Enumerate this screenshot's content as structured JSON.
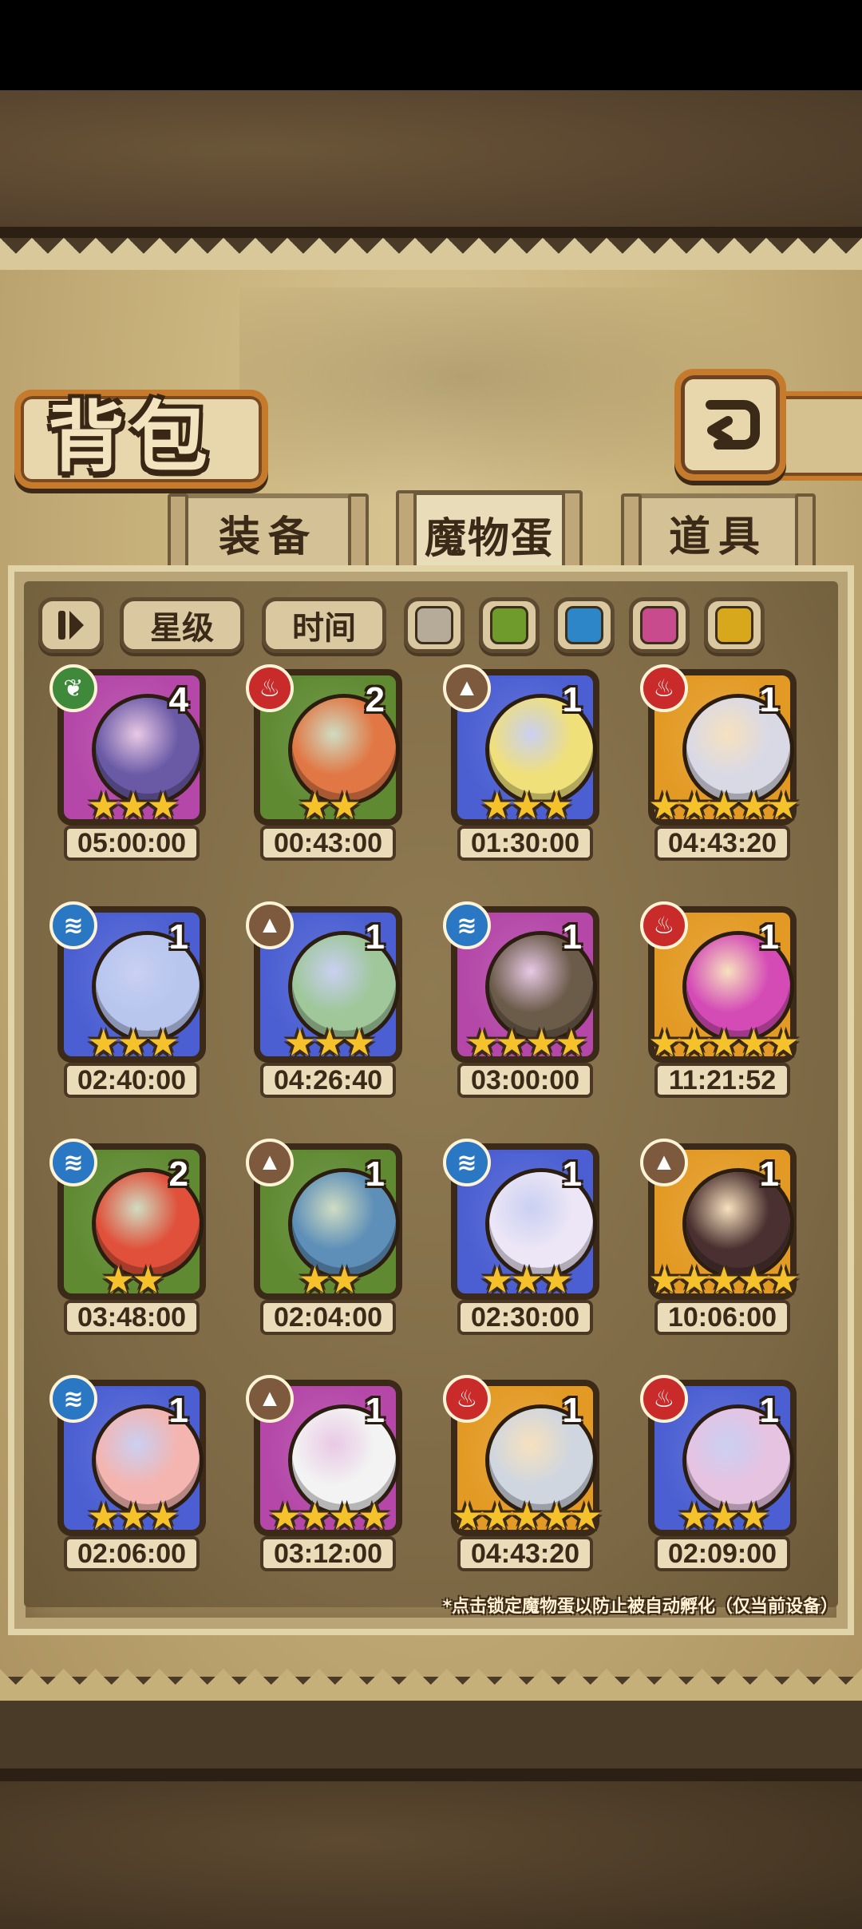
{
  "title": "背包",
  "back_icon": "back-arrow-icon",
  "tabs": [
    {
      "label": "装备",
      "active": false
    },
    {
      "label": "魔物蛋",
      "active": true
    },
    {
      "label": "道具",
      "active": false
    }
  ],
  "filters": {
    "pause_icon": "sort-toggle-icon",
    "star_label": "星级",
    "time_label": "时间",
    "colors": [
      "#b5ab98",
      "#6f9a2c",
      "#2c86c8",
      "#c84b8e",
      "#d7a71c"
    ]
  },
  "element_colors": {
    "nature": "#3e8a3a",
    "fire": "#c92a2a",
    "earth": "#7d5a3e",
    "water": "#2a78c4"
  },
  "rarity_colors": {
    "purple": "#b447a8",
    "green": "#5f8a32",
    "blue": "#4b5fd2",
    "orange": "#e39a24"
  },
  "eggs": [
    {
      "element": "nature",
      "rarity": "purple",
      "count": "4",
      "stars": 3,
      "time": "05:00:00",
      "icon": "dark-knight-egg-icon",
      "tint": "#6a5aa6"
    },
    {
      "element": "fire",
      "rarity": "green",
      "count": "2",
      "stars": 2,
      "time": "00:43:00",
      "icon": "orange-bunny-egg-icon",
      "tint": "#e17744"
    },
    {
      "element": "earth",
      "rarity": "blue",
      "count": "1",
      "stars": 3,
      "time": "01:30:00",
      "icon": "jellyfish-egg-icon",
      "tint": "#f0e07a"
    },
    {
      "element": "fire",
      "rarity": "orange",
      "count": "1",
      "stars": 5,
      "time": "04:43:20",
      "icon": "wizard-hat-egg-icon",
      "tint": "#d9d9e6"
    },
    {
      "element": "water",
      "rarity": "blue",
      "count": "1",
      "stars": 3,
      "time": "02:40:00",
      "icon": "crystal-egg-icon",
      "tint": "#b8c6ee"
    },
    {
      "element": "earth",
      "rarity": "blue",
      "count": "1",
      "stars": 3,
      "time": "04:26:40",
      "icon": "green-beast-egg-icon",
      "tint": "#9fc79a"
    },
    {
      "element": "water",
      "rarity": "purple",
      "count": "1",
      "stars": 4,
      "time": "03:00:00",
      "icon": "hooded-egg-icon",
      "tint": "#6b5c4a"
    },
    {
      "element": "fire",
      "rarity": "orange",
      "count": "1",
      "stars": 5,
      "time": "11:21:52",
      "icon": "pink-orb-egg-icon",
      "tint": "#d44bb6"
    },
    {
      "element": "water",
      "rarity": "green",
      "count": "2",
      "stars": 2,
      "time": "03:48:00",
      "icon": "crab-egg-icon",
      "tint": "#e0503a"
    },
    {
      "element": "earth",
      "rarity": "green",
      "count": "1",
      "stars": 2,
      "time": "02:04:00",
      "icon": "fish-tail-egg-icon",
      "tint": "#5e8fb8"
    },
    {
      "element": "water",
      "rarity": "blue",
      "count": "1",
      "stars": 3,
      "time": "02:30:00",
      "icon": "masked-egg-icon",
      "tint": "#ece6f6"
    },
    {
      "element": "earth",
      "rarity": "orange",
      "count": "1",
      "stars": 5,
      "time": "10:06:00",
      "icon": "coffin-egg-icon",
      "tint": "#4a3030"
    },
    {
      "element": "water",
      "rarity": "blue",
      "count": "1",
      "stars": 3,
      "time": "02:06:00",
      "icon": "peach-egg-icon",
      "tint": "#f4b5b0"
    },
    {
      "element": "earth",
      "rarity": "purple",
      "count": "1",
      "stars": 4,
      "time": "03:12:00",
      "icon": "cracked-skull-egg-icon",
      "tint": "#f3f3f3"
    },
    {
      "element": "fire",
      "rarity": "orange",
      "count": "1",
      "stars": 5,
      "time": "04:43:20",
      "icon": "sword-egg-icon",
      "tint": "#cfd6e0"
    },
    {
      "element": "fire",
      "rarity": "blue",
      "count": "1",
      "stars": 3,
      "time": "02:09:00",
      "icon": "mushroom-egg-icon",
      "tint": "#e7c3e2"
    }
  ],
  "footnote": "*点击锁定魔物蛋以防止被自动孵化（仅当前设备）"
}
